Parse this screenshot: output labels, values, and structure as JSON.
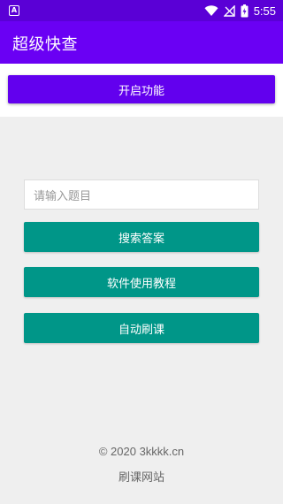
{
  "status_bar": {
    "left_icon": "A",
    "time": "5:55",
    "icons": [
      "wifi-icon",
      "signal-icon",
      "battery-icon"
    ]
  },
  "app_bar": {
    "title": "超级快查"
  },
  "top": {
    "enable_button": "开启功能"
  },
  "form": {
    "placeholder": "请输入题目",
    "search_button": "搜索答案",
    "tutorial_button": "软件使用教程",
    "auto_button": "自动刷课"
  },
  "footer": {
    "copyright": "© 2020   3kkkk.cn",
    "site_name": "刷课网站"
  },
  "colors": {
    "primary": "#6200ee",
    "status_bar": "#5a00d6",
    "teal": "#009688"
  }
}
